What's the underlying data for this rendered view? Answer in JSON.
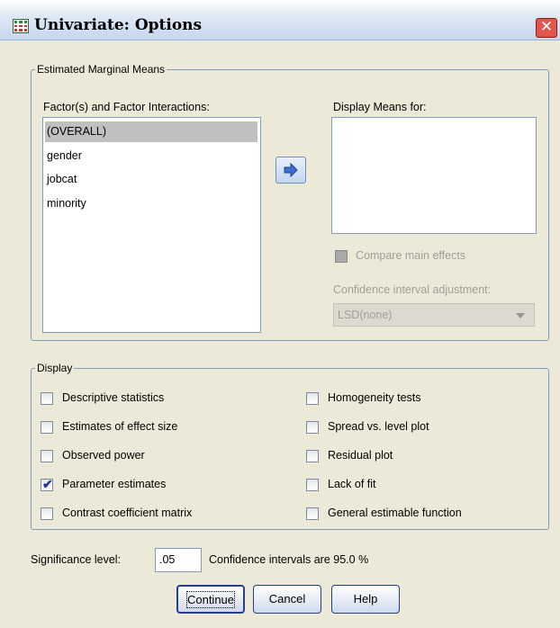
{
  "window": {
    "title": "Univariate: Options",
    "close_glyph": "✕"
  },
  "emm": {
    "legend": "Estimated Marginal Means",
    "factors_label": "Factor(s) and Factor Interactions:",
    "factors": [
      {
        "label": "(OVERALL)",
        "selected": true
      },
      {
        "label": "gender",
        "selected": false
      },
      {
        "label": "jobcat",
        "selected": false
      },
      {
        "label": "minority",
        "selected": false
      }
    ],
    "display_means_label": "Display Means for:",
    "display_means": [],
    "compare_main_effects": {
      "label": "Compare main effects",
      "checked": false,
      "enabled": false
    },
    "ci_adjustment_label": "Confidence interval adjustment:",
    "ci_adjustment_value": "LSD(none)",
    "move_icon": "right-arrow-icon"
  },
  "display": {
    "legend": "Display",
    "left": [
      {
        "label": "Descriptive statistics",
        "checked": false
      },
      {
        "label": "Estimates of effect size",
        "checked": false
      },
      {
        "label": "Observed power",
        "checked": false
      },
      {
        "label": "Parameter estimates",
        "checked": true
      },
      {
        "label": "Contrast coefficient matrix",
        "checked": false
      }
    ],
    "right": [
      {
        "label": "Homogeneity tests",
        "checked": false
      },
      {
        "label": "Spread vs. level plot",
        "checked": false
      },
      {
        "label": "Residual plot",
        "checked": false
      },
      {
        "label": "Lack of fit",
        "checked": false
      },
      {
        "label": "General estimable function",
        "checked": false
      }
    ]
  },
  "significance": {
    "label": "Significance level:",
    "value": ".05",
    "ci_text": "Confidence intervals are 95.0 %"
  },
  "buttons": {
    "continue": "Continue",
    "cancel": "Cancel",
    "help": "Help"
  },
  "colors": {
    "dialog_bg": "#ece9d8",
    "accent": "#3f6fd0",
    "check_color": "#21359e"
  }
}
